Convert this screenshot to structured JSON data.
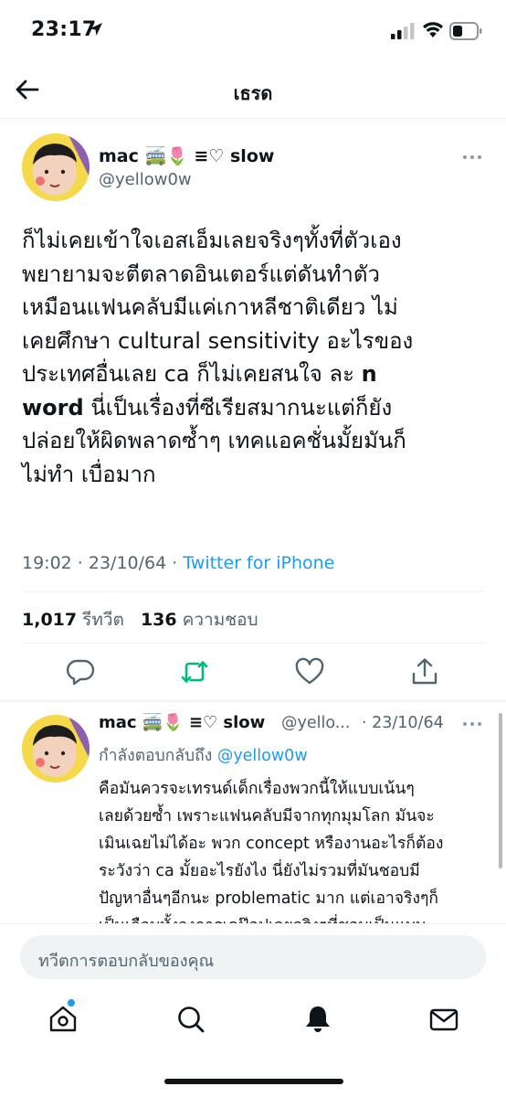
{
  "status_bar": {
    "time": "23:17"
  },
  "header": {
    "title": "เธรด"
  },
  "main_tweet": {
    "display_name": "mac 🚎🌷 ≡♡ slow",
    "handle": "@yellow0w",
    "text_lines": [
      "ก็ไม่เคยเข้าใจเอสเอ็มเลยจริงๆทั้งที่ตัวเอง",
      "พยายามจะตีตลาดอินเตอร์แต่ดันทำตัว",
      "เหมือนแฟนคลับมีแค่เกาหลีชาติเดียว ไม่",
      "เคยศึกษา cultural sensitivity อะไรของ",
      "ประเทศอื่นเลย ca ก็ไม่เคยสนใจ ละ ",
      "n",
      "word",
      " นี่เป็นเรื่องที่ซีเรียสมากนะแต่ก็ยัง",
      "ปล่อยให้ผิดพลาดซ้ำๆ เทคแอคชั่นมั้ยมันก็",
      "ไม่ทำ เบื่อมาก"
    ],
    "timestamp": "19:02 · 23/10/64 · ",
    "source": "Twitter for iPhone",
    "retweets_count": "1,017",
    "retweets_label": "รีทวีต",
    "likes_count": "136",
    "likes_label": "ความชอบ"
  },
  "reply": {
    "display_name": "mac 🚎🌷 ≡♡ slow",
    "handle": "@yello...",
    "date": "· 23/10/64",
    "replying_label": "กำลังตอบกลับถึง ",
    "replying_to": "@yellow0w",
    "text_lines": [
      "คือมันควรจะเทรนด์เด็กเรื่องพวกนี้ให้แบบเน้นๆ",
      "เลยด้วยซ้ำ เพราะแฟนคลับมีจากทุกมุมโลก มันจะ",
      "เมินเฉยไม่ได้อะ พวก concept หรืองานอะไรก็ต้อง",
      "ระวังว่า ca มั้ยอะไรยังไง นี่ยังไม่รวมที่มันชอบมี",
      "ปัญหาอื่นๆอีกนะ problematic มาก แต่เอาจริงๆก็",
      "เป็นเกือบทั้งวงการเคป๊อปเลยจริงๆที่ชอบเป็นแบบ"
    ]
  },
  "compose": {
    "placeholder": "ทวีตการตอบกลับของคุณ"
  },
  "colors": {
    "accent": "#1d9bf0",
    "retweet": "#00ba7c",
    "muted": "#536471",
    "text": "#0f1419"
  },
  "icons": [
    "location-arrow-icon",
    "signal-icon",
    "wifi-icon",
    "battery-icon",
    "back-arrow-icon",
    "more-icon",
    "reply-icon",
    "retweet-icon",
    "like-icon",
    "share-icon",
    "home-icon",
    "search-icon",
    "notifications-icon",
    "messages-icon"
  ]
}
